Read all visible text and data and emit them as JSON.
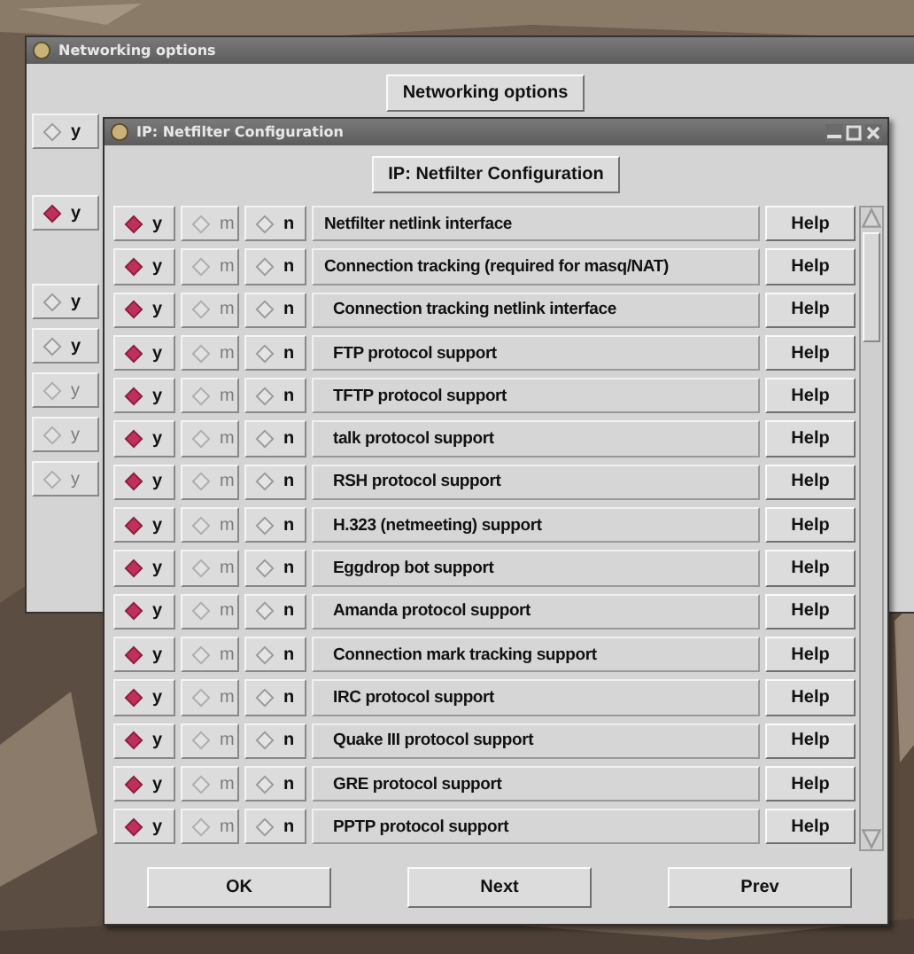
{
  "back_window": {
    "title": "Networking options",
    "header_button": "Networking options",
    "rows": [
      {
        "label": "y",
        "selected": false,
        "disabled": false
      },
      {
        "label": "y",
        "selected": true,
        "disabled": false
      },
      {
        "label": "y",
        "selected": false,
        "disabled": false
      },
      {
        "label": "y",
        "selected": false,
        "disabled": false
      },
      {
        "label": "y",
        "selected": false,
        "disabled": true
      },
      {
        "label": "y",
        "selected": false,
        "disabled": true
      },
      {
        "label": "y",
        "selected": false,
        "disabled": true
      }
    ]
  },
  "window": {
    "title": "IP: Netfilter Configuration",
    "header_button": "IP: Netfilter Configuration",
    "options": [
      {
        "choices": [
          {
            "label": "y",
            "selected": true,
            "disabled": false
          },
          {
            "label": "m",
            "selected": false,
            "disabled": true
          },
          {
            "label": "n",
            "selected": false,
            "disabled": false
          }
        ],
        "label": "Netfilter netlink interface",
        "help": "Help"
      },
      {
        "choices": [
          {
            "label": "y",
            "selected": true,
            "disabled": false
          },
          {
            "label": "m",
            "selected": false,
            "disabled": true
          },
          {
            "label": "n",
            "selected": false,
            "disabled": false
          }
        ],
        "label": "Connection tracking (required for masq/NAT)",
        "help": "Help",
        "children": [
          {
            "choices": [
              {
                "label": "y",
                "selected": true,
                "disabled": false
              },
              {
                "label": "m",
                "selected": false,
                "disabled": true
              },
              {
                "label": "n",
                "selected": false,
                "disabled": false
              }
            ],
            "label": "Connection tracking netlink interface",
            "help": "Help"
          },
          {
            "choices": [
              {
                "label": "y",
                "selected": true,
                "disabled": false
              },
              {
                "label": "m",
                "selected": false,
                "disabled": true
              },
              {
                "label": "n",
                "selected": false,
                "disabled": false
              }
            ],
            "label": "FTP protocol support",
            "help": "Help"
          },
          {
            "choices": [
              {
                "label": "y",
                "selected": true,
                "disabled": false
              },
              {
                "label": "m",
                "selected": false,
                "disabled": true
              },
              {
                "label": "n",
                "selected": false,
                "disabled": false
              }
            ],
            "label": "TFTP protocol support",
            "help": "Help"
          },
          {
            "choices": [
              {
                "label": "y",
                "selected": true,
                "disabled": false
              },
              {
                "label": "m",
                "selected": false,
                "disabled": true
              },
              {
                "label": "n",
                "selected": false,
                "disabled": false
              }
            ],
            "label": "talk protocol support",
            "help": "Help"
          },
          {
            "choices": [
              {
                "label": "y",
                "selected": true,
                "disabled": false
              },
              {
                "label": "m",
                "selected": false,
                "disabled": true
              },
              {
                "label": "n",
                "selected": false,
                "disabled": false
              }
            ],
            "label": "RSH protocol support",
            "help": "Help"
          },
          {
            "choices": [
              {
                "label": "y",
                "selected": true,
                "disabled": false
              },
              {
                "label": "m",
                "selected": false,
                "disabled": true
              },
              {
                "label": "n",
                "selected": false,
                "disabled": false
              }
            ],
            "label": "H.323 (netmeeting) support",
            "help": "Help"
          },
          {
            "choices": [
              {
                "label": "y",
                "selected": true,
                "disabled": false
              },
              {
                "label": "m",
                "selected": false,
                "disabled": true
              },
              {
                "label": "n",
                "selected": false,
                "disabled": false
              }
            ],
            "label": "Eggdrop bot support",
            "help": "Help"
          },
          {
            "choices": [
              {
                "label": "y",
                "selected": true,
                "disabled": false
              },
              {
                "label": "m",
                "selected": false,
                "disabled": true
              },
              {
                "label": "n",
                "selected": false,
                "disabled": false
              }
            ],
            "label": "Amanda protocol support",
            "help": "Help"
          },
          {
            "choices": [
              {
                "label": "y",
                "selected": true,
                "disabled": false
              },
              {
                "label": "m",
                "selected": false,
                "disabled": true
              },
              {
                "label": "n",
                "selected": false,
                "disabled": false
              }
            ],
            "label": "Connection mark tracking support",
            "help": "Help"
          },
          {
            "choices": [
              {
                "label": "y",
                "selected": true,
                "disabled": false
              },
              {
                "label": "m",
                "selected": false,
                "disabled": true
              },
              {
                "label": "n",
                "selected": false,
                "disabled": false
              }
            ],
            "label": "IRC protocol support",
            "help": "Help"
          },
          {
            "choices": [
              {
                "label": "y",
                "selected": true,
                "disabled": false
              },
              {
                "label": "m",
                "selected": false,
                "disabled": true
              },
              {
                "label": "n",
                "selected": false,
                "disabled": false
              }
            ],
            "label": "Quake III protocol support",
            "help": "Help"
          },
          {
            "choices": [
              {
                "label": "y",
                "selected": true,
                "disabled": false
              },
              {
                "label": "m",
                "selected": false,
                "disabled": true
              },
              {
                "label": "n",
                "selected": false,
                "disabled": false
              }
            ],
            "label": "GRE protocol support",
            "help": "Help"
          },
          {
            "choices": [
              {
                "label": "y",
                "selected": true,
                "disabled": false
              },
              {
                "label": "m",
                "selected": false,
                "disabled": true
              },
              {
                "label": "n",
                "selected": false,
                "disabled": false
              }
            ],
            "label": "PPTP protocol support",
            "help": "Help"
          }
        ]
      }
    ],
    "buttons": [
      "OK",
      "Next",
      "Prev"
    ]
  }
}
